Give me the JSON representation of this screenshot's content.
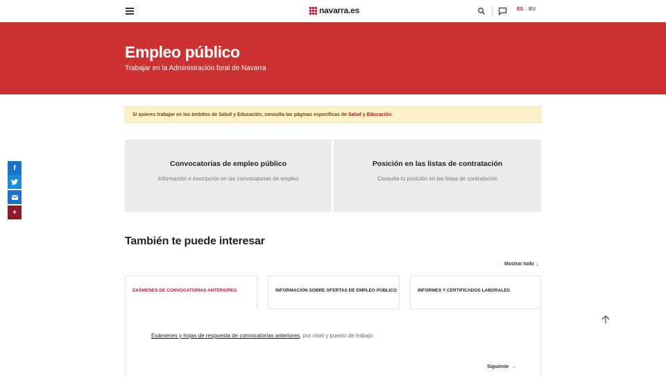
{
  "header": {
    "logo_text": "navarra.es",
    "lang_es": "ES",
    "lang_sep": "|",
    "lang_eu": "EU",
    "icons": [
      "hamburger-icon",
      "search-icon",
      "chat-icon"
    ]
  },
  "hero": {
    "title": "Empleo público",
    "subtitle": "Trabajar en la Administración foral de Navarra"
  },
  "notice": {
    "text_before": "Si quieres trabajar en los ámbitos de Salud y Educación, consulta las páginas específicas de ",
    "link_salud": "Salud",
    "text_and": " y ",
    "link_educacion": "Educación",
    "text_after": "."
  },
  "cards": [
    {
      "title": "Convocatorias de empleo público",
      "description": "Información e inscripción en las convocatorias de empleo"
    },
    {
      "title": "Posición en las listas de contratación",
      "description": "Consulta tu posición en las listas de contratación"
    }
  ],
  "related": {
    "title": "También te puede interesar",
    "show_all": "Mostrar todo",
    "show_all_arrow": "↓",
    "tabs": [
      "EXÁMENES DE CONVOCATORIAS ANTERIORES",
      "INFORMACIÓN SOBRE OFERTAS DE EMPLEO PÚBLICO",
      "INFORMES Y CERTIFICADOS LABORALES"
    ],
    "panel_link": "Exámenes y hojas de respuesta de convocatorias anteriores",
    "panel_rest": ", por nivel y puesto de trabajo",
    "next": "Siguiente",
    "next_arrow": "→"
  },
  "social": {
    "facebook": "f",
    "twitter": "t",
    "email": "✉",
    "more": "+"
  },
  "colors": {
    "brand_red": "#cc3232",
    "accent_red": "#c8102e",
    "notice_bg": "#fdf1c8",
    "card_bg": "#ebebeb",
    "facebook_blue": "#1a73c6",
    "twitter_blue": "#1a8ad8",
    "more_red": "#8c1a2a"
  }
}
